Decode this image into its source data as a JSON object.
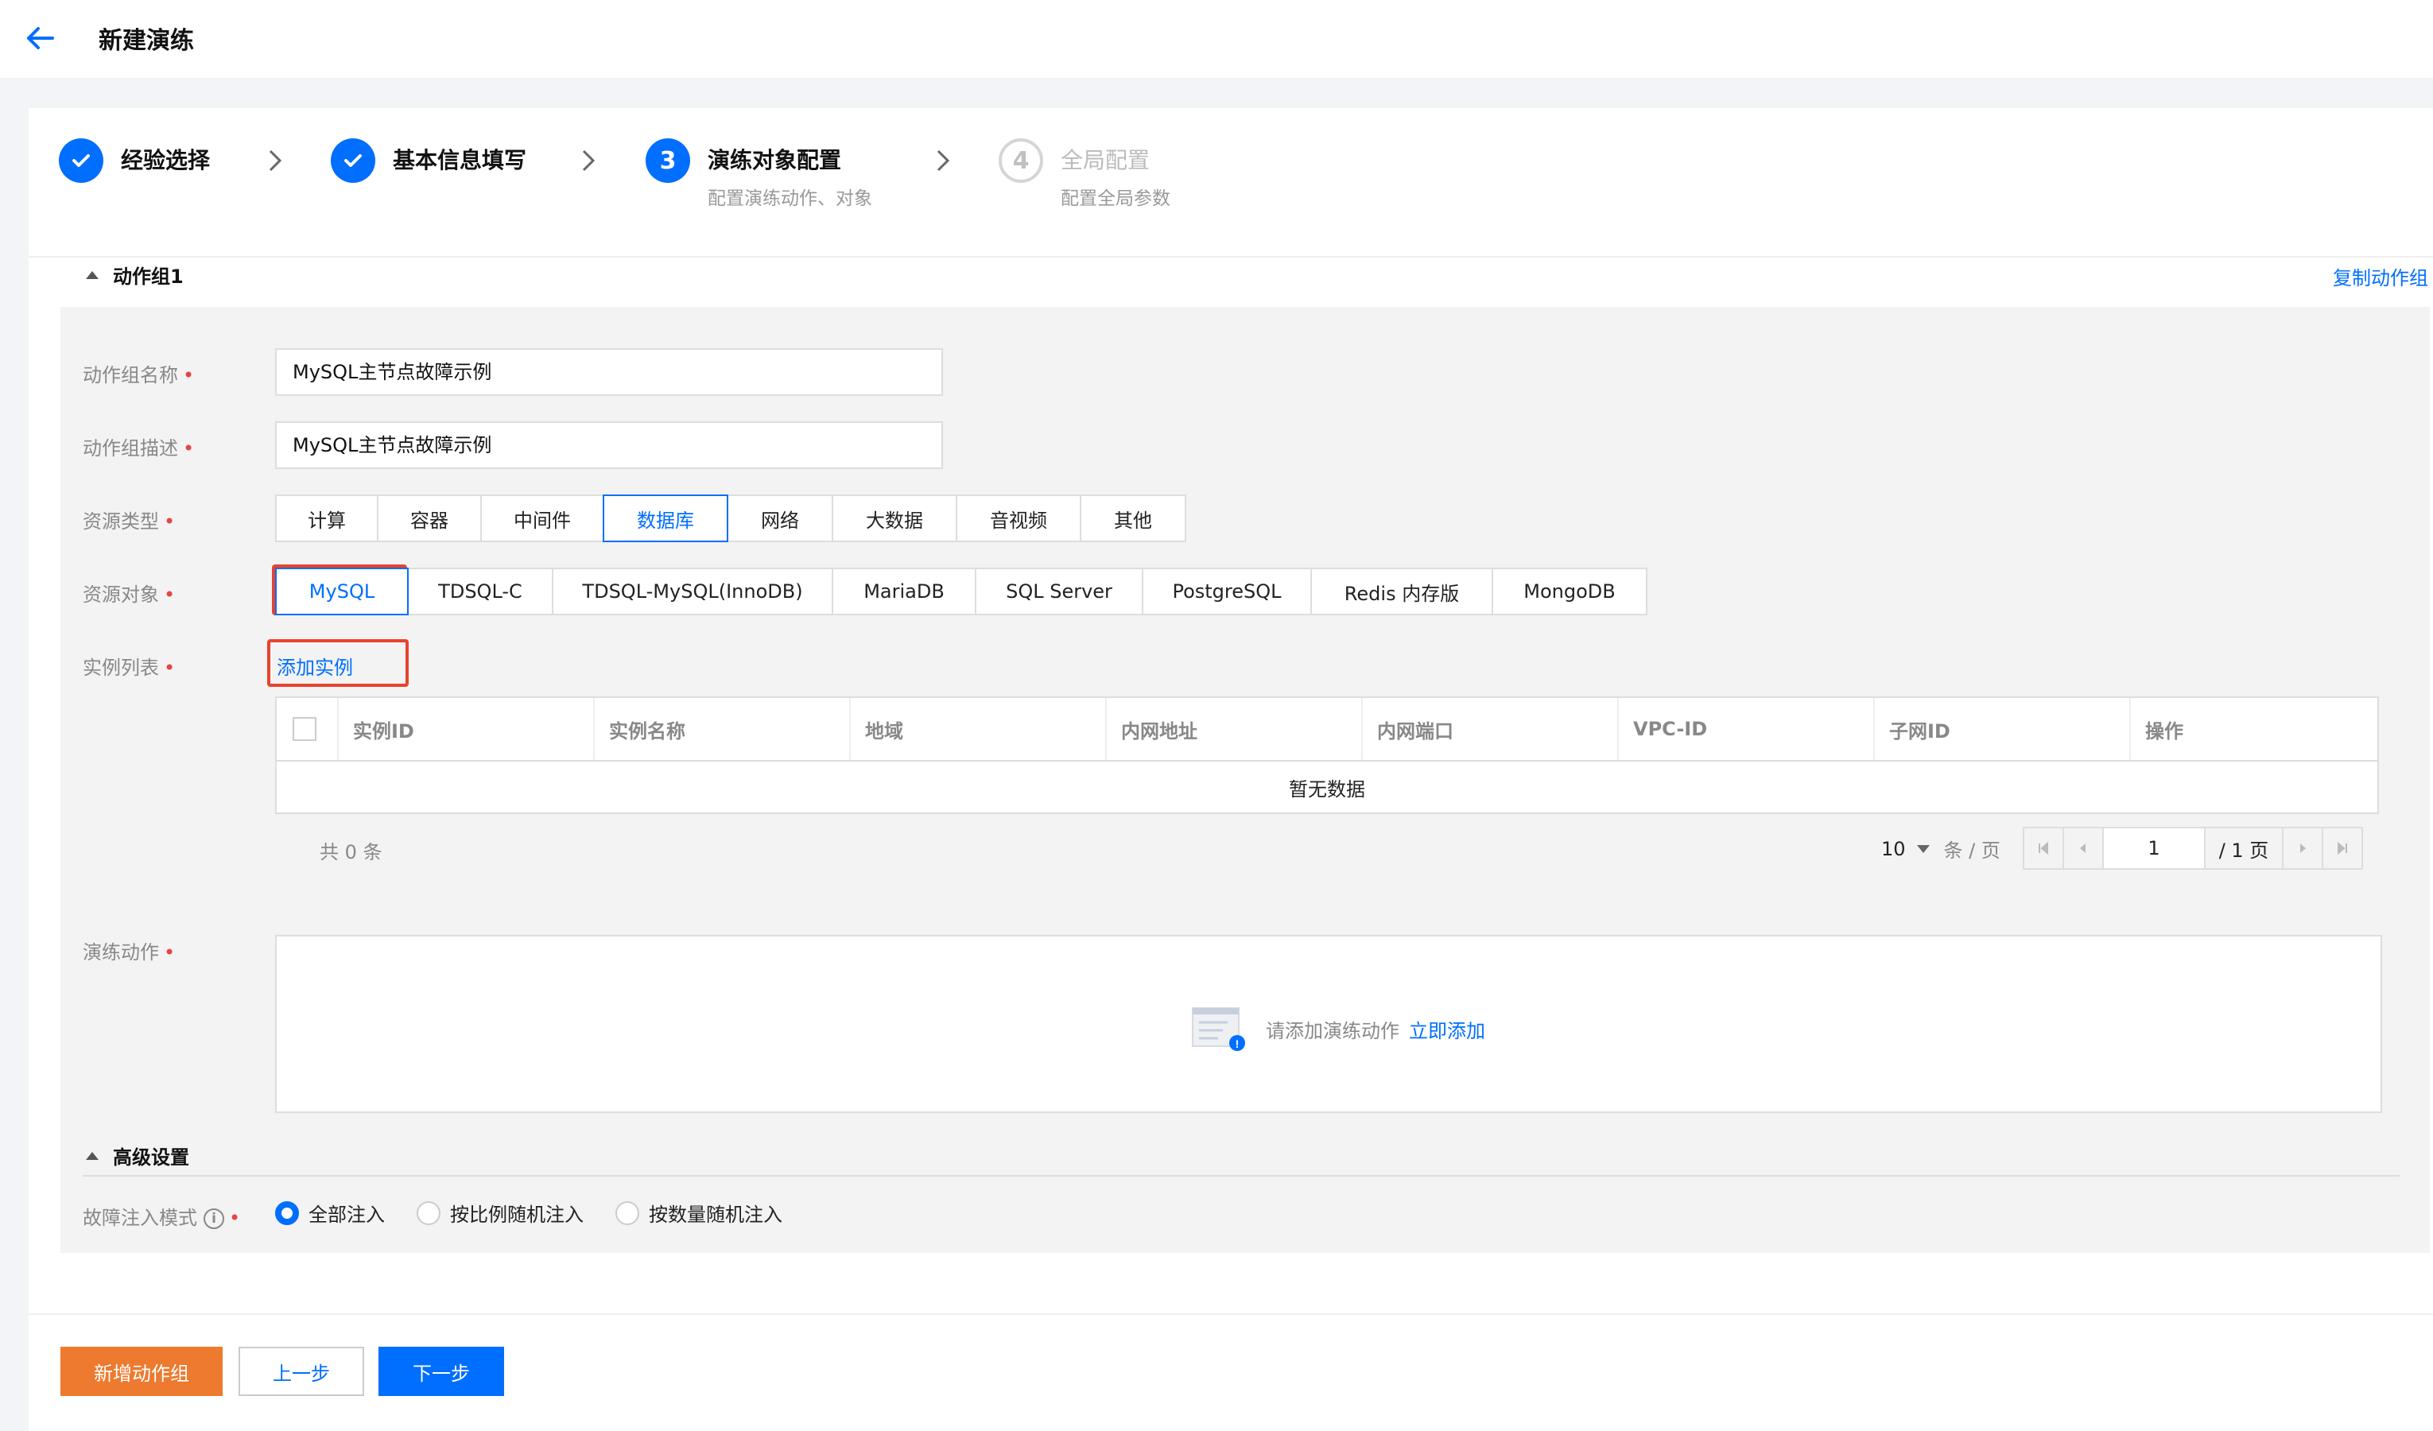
{
  "header": {
    "title": "新建演练"
  },
  "steps": [
    {
      "title": "经验选择",
      "status": "done",
      "subtitle": ""
    },
    {
      "title": "基本信息填写",
      "status": "done",
      "subtitle": ""
    },
    {
      "title": "演练对象配置",
      "status": "active",
      "number": "3",
      "subtitle": "配置演练动作、对象"
    },
    {
      "title": "全局配置",
      "status": "pending",
      "number": "4",
      "subtitle": "配置全局参数"
    }
  ],
  "group": {
    "title": "动作组1",
    "copy_label": "复制动作组",
    "name_label": "动作组名称",
    "name_value": "MySQL主节点故障示例",
    "desc_label": "动作组描述",
    "desc_value": "MySQL主节点故障示例",
    "resource_type_label": "资源类型",
    "resource_types": [
      "计算",
      "容器",
      "中间件",
      "数据库",
      "网络",
      "大数据",
      "音视频",
      "其他"
    ],
    "resource_type_selected": "数据库",
    "resource_object_label": "资源对象",
    "resource_objects": [
      "MySQL",
      "TDSQL-C",
      "TDSQL-MySQL(InnoDB)",
      "MariaDB",
      "SQL Server",
      "PostgreSQL",
      "Redis 内存版",
      "MongoDB"
    ],
    "resource_object_selected": "MySQL",
    "instance_list_label": "实例列表",
    "add_instance_label": "添加实例",
    "table": {
      "columns": [
        "实例ID",
        "实例名称",
        "地域",
        "内网地址",
        "内网端口",
        "VPC-ID",
        "子网ID",
        "操作"
      ],
      "empty_text": "暂无数据"
    },
    "pagination": {
      "total_text": "共 0 条",
      "page_size": "10",
      "per_page_suffix": "条 / 页",
      "current_page": "1",
      "total_pages": "/ 1 页"
    },
    "actions_label": "演练动作",
    "actions_empty_text": "请添加演练动作",
    "actions_add_now": "立即添加"
  },
  "advanced": {
    "title": "高级设置",
    "inject_mode_label": "故障注入模式",
    "inject_modes": [
      "全部注入",
      "按比例随机注入",
      "按数量随机注入"
    ],
    "inject_mode_selected": "全部注入"
  },
  "footer": {
    "add_group_label": "新增动作组",
    "prev_label": "上一步",
    "next_label": "下一步"
  },
  "colors": {
    "primary": "#006eff",
    "orange": "#ed7a2e",
    "required": "#e54545",
    "highlight": "#e8432d"
  }
}
